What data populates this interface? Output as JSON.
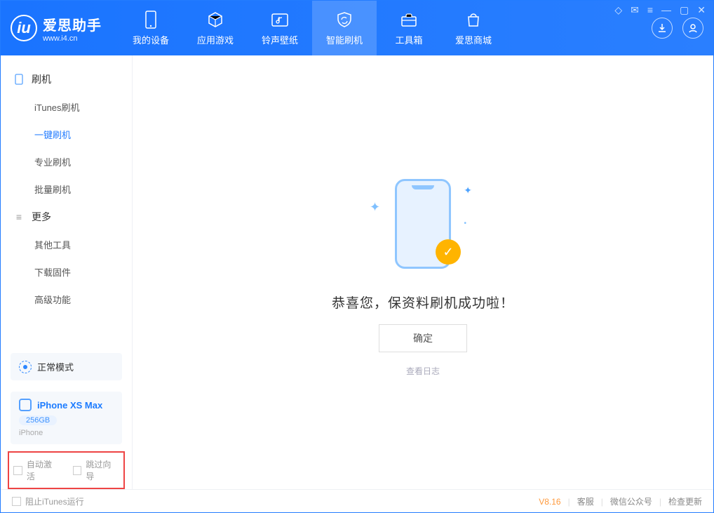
{
  "app": {
    "title": "爱思助手",
    "subtitle": "www.i4.cn"
  },
  "tabs": {
    "device": "我的设备",
    "apps": "应用游戏",
    "ring": "铃声壁纸",
    "flash": "智能刷机",
    "tools": "工具箱",
    "store": "爱思商城"
  },
  "sidebar": {
    "section_flash": "刷机",
    "itunes": "iTunes刷机",
    "onekey": "一键刷机",
    "pro": "专业刷机",
    "batch": "批量刷机",
    "section_more": "更多",
    "other": "其他工具",
    "firmware": "下载固件",
    "advanced": "高级功能"
  },
  "mode": {
    "label": "正常模式"
  },
  "device": {
    "name": "iPhone XS Max",
    "capacity": "256GB",
    "type": "iPhone"
  },
  "checks": {
    "auto_activate": "自动激活",
    "skip_guide": "跳过向导"
  },
  "main": {
    "message": "恭喜您，保资料刷机成功啦！",
    "ok": "确定",
    "log": "查看日志"
  },
  "footer": {
    "block_itunes": "阻止iTunes运行",
    "version": "V8.16",
    "support": "客服",
    "wechat": "微信公众号",
    "update": "检查更新"
  }
}
